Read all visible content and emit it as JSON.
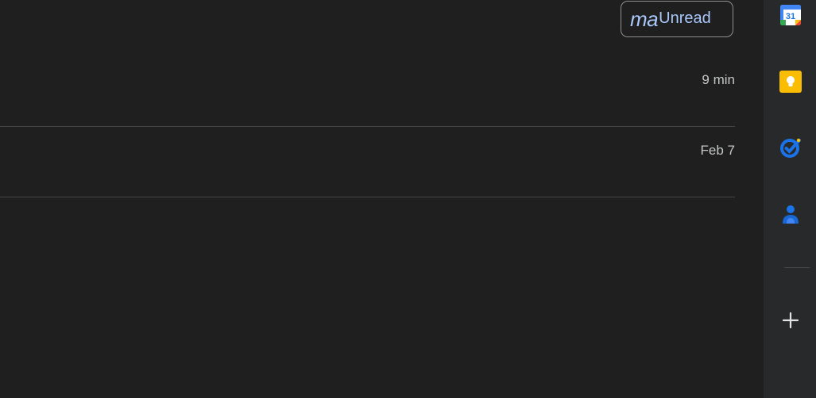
{
  "filter_chip": {
    "prefix": "ma",
    "label": "Unread"
  },
  "rows": [
    {
      "date": "9 min"
    },
    {
      "date": "Feb 7"
    }
  ],
  "side_panel": {
    "apps": [
      {
        "icon": "calendar-icon",
        "text": "31",
        "color": "#1a73e8"
      },
      {
        "icon": "keep-icon",
        "color": "#fbbc04"
      },
      {
        "icon": "tasks-icon",
        "color": "#1a73e8"
      },
      {
        "icon": "contacts-icon",
        "color": "#1a73e8"
      }
    ],
    "add_icon": "plus-icon"
  },
  "colors": {
    "background": "#1f1f1f",
    "side_panel": "#28292a",
    "accent": "#a8c7fa",
    "text_secondary": "#c4c7c5",
    "divider": "#444746"
  }
}
